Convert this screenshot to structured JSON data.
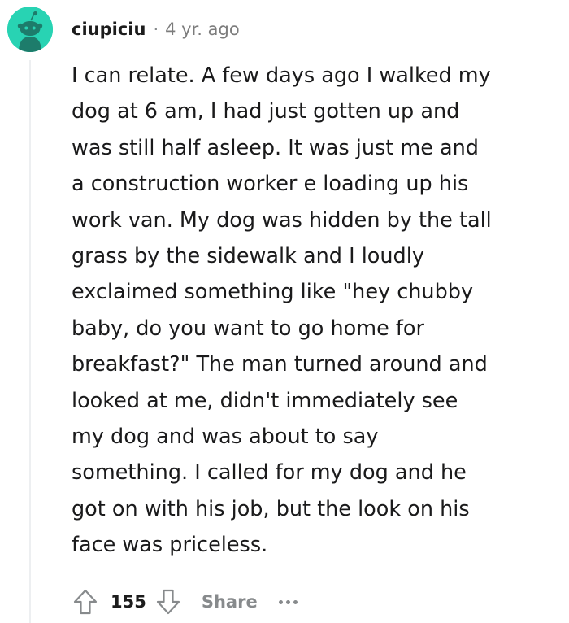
{
  "comment": {
    "author": "ciupiciu",
    "separator": "·",
    "age": "4 yr. ago",
    "body": "I can relate. A few days ago I walked my\ndog at 6 am, I had just gotten up and\nwas still half asleep. It was just me and\na construction worker e loading up his\nwork van. My dog was hidden by the tall\ngrass by the sidewalk and I loudly\nexclaimed something like \"hey chubby\nbaby, do you want to go home for\nbreakfast?\" The man turned around and\nlooked at me, didn't immediately see\nmy dog and was about to say\nsomething. I called for my dog and he\ngot on with his job, but the look on his\nface was priceless.",
    "score": "155",
    "share_label": "Share"
  },
  "icons": {
    "avatar": "snoo-avatar-icon",
    "upvote": "upvote-arrow-icon",
    "downvote": "downvote-arrow-icon",
    "more": "more-options-icon"
  },
  "colors": {
    "avatar_bg": "#28d3b3",
    "text": "#1a1a1b",
    "muted": "#878a8c",
    "thread_line": "#edeff1"
  }
}
